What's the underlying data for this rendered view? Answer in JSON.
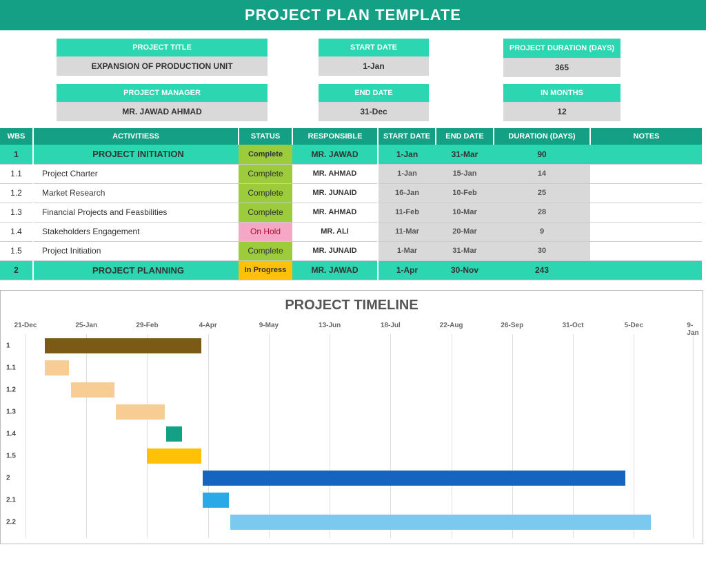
{
  "title": "PROJECT PLAN TEMPLATE",
  "meta": {
    "project_title": {
      "label": "PROJECT TITLE",
      "value": "EXPANSION OF PRODUCTION UNIT"
    },
    "start_date": {
      "label": "START DATE",
      "value": "1-Jan"
    },
    "duration_days": {
      "label": "PROJECT DURATION (DAYS)",
      "value": "365"
    },
    "manager": {
      "label": "PROJECT MANAGER",
      "value": "MR. JAWAD AHMAD"
    },
    "end_date": {
      "label": "END DATE",
      "value": "31-Dec"
    },
    "in_months": {
      "label": "IN MONTHS",
      "value": "12"
    }
  },
  "columns": {
    "wbs": "WBS",
    "activities": "ACTIVITIESS",
    "status": "STATUS",
    "responsible": "RESPONSIBLE",
    "start": "START DATE",
    "end": "END DATE",
    "duration": "DURATION (DAYS)",
    "notes": "NOTES"
  },
  "rows": [
    {
      "group": true,
      "wbs": "1",
      "activity": "PROJECT INITIATION",
      "status": "Complete",
      "status_cls": "st-g-complete",
      "resp": "MR. JAWAD",
      "start": "1-Jan",
      "end": "31-Mar",
      "dur": "90"
    },
    {
      "group": false,
      "wbs": "1.1",
      "activity": "Project Charter",
      "status": "Complete",
      "status_cls": "st-complete",
      "resp": "MR. AHMAD",
      "start": "1-Jan",
      "end": "15-Jan",
      "dur": "14"
    },
    {
      "group": false,
      "wbs": "1.2",
      "activity": "Market Research",
      "status": "Complete",
      "status_cls": "st-complete",
      "resp": "MR. JUNAID",
      "start": "16-Jan",
      "end": "10-Feb",
      "dur": "25"
    },
    {
      "group": false,
      "wbs": "1.3",
      "activity": "Financial Projects and Feasbilities",
      "status": "Complete",
      "status_cls": "st-complete",
      "resp": "MR. AHMAD",
      "start": "11-Feb",
      "end": "10-Mar",
      "dur": "28"
    },
    {
      "group": false,
      "wbs": "1.4",
      "activity": "Stakeholders Engagement",
      "status": "On Hold",
      "status_cls": "st-onhold",
      "resp": "MR. ALI",
      "start": "11-Mar",
      "end": "20-Mar",
      "dur": "9"
    },
    {
      "group": false,
      "wbs": "1.5",
      "activity": "Project Initiation",
      "status": "Complete",
      "status_cls": "st-complete",
      "resp": "MR. JUNAID",
      "start": "1-Mar",
      "end": "31-Mar",
      "dur": "30"
    },
    {
      "group": true,
      "wbs": "2",
      "activity": "PROJECT PLANNING",
      "status": "In Progress",
      "status_cls": "st-g-inprog",
      "resp": "MR. JAWAD",
      "start": "1-Apr",
      "end": "30-Nov",
      "dur": "243"
    }
  ],
  "timeline": {
    "title": "PROJECT TIMELINE",
    "start_day": 0,
    "end_day": 384,
    "dates": [
      {
        "label": "21-Dec",
        "day": 0
      },
      {
        "label": "25-Jan",
        "day": 35
      },
      {
        "label": "29-Feb",
        "day": 70
      },
      {
        "label": "4-Apr",
        "day": 105
      },
      {
        "label": "9-May",
        "day": 140
      },
      {
        "label": "13-Jun",
        "day": 175
      },
      {
        "label": "18-Jul",
        "day": 210
      },
      {
        "label": "22-Aug",
        "day": 245
      },
      {
        "label": "26-Sep",
        "day": 280
      },
      {
        "label": "31-Oct",
        "day": 315
      },
      {
        "label": "5-Dec",
        "day": 350
      },
      {
        "label": "9-Jan",
        "day": 384
      }
    ],
    "rows": [
      {
        "label": "1",
        "cls": "bar-1",
        "start": 11,
        "end": 101
      },
      {
        "label": "1.1",
        "cls": "bar-11",
        "start": 11,
        "end": 25
      },
      {
        "label": "1.2",
        "cls": "bar-12",
        "start": 26,
        "end": 51
      },
      {
        "label": "1.3",
        "cls": "bar-13",
        "start": 52,
        "end": 80
      },
      {
        "label": "1.4",
        "cls": "bar-14",
        "start": 81,
        "end": 90
      },
      {
        "label": "1.5",
        "cls": "bar-15",
        "start": 70,
        "end": 101
      },
      {
        "label": "2",
        "cls": "bar-2",
        "start": 102,
        "end": 345
      },
      {
        "label": "2.1",
        "cls": "bar-21",
        "start": 102,
        "end": 117
      },
      {
        "label": "2.2",
        "cls": "bar-22",
        "start": 118,
        "end": 360
      }
    ]
  },
  "chart_data": {
    "type": "bar",
    "title": "PROJECT TIMELINE",
    "xlabel": "",
    "ylabel": "",
    "x_ticks": [
      "21-Dec",
      "25-Jan",
      "29-Feb",
      "4-Apr",
      "9-May",
      "13-Jun",
      "18-Jul",
      "22-Aug",
      "26-Sep",
      "31-Oct",
      "5-Dec",
      "9-Jan"
    ],
    "series": [
      {
        "name": "1",
        "start": "1-Jan",
        "end": "31-Mar",
        "duration": 90,
        "color": "#7b5a16"
      },
      {
        "name": "1.1",
        "start": "1-Jan",
        "end": "15-Jan",
        "duration": 14,
        "color": "#f7cd94"
      },
      {
        "name": "1.2",
        "start": "16-Jan",
        "end": "10-Feb",
        "duration": 25,
        "color": "#f7cd94"
      },
      {
        "name": "1.3",
        "start": "11-Feb",
        "end": "10-Mar",
        "duration": 28,
        "color": "#f7cd94"
      },
      {
        "name": "1.4",
        "start": "11-Mar",
        "end": "20-Mar",
        "duration": 9,
        "color": "#14a085"
      },
      {
        "name": "1.5",
        "start": "1-Mar",
        "end": "31-Mar",
        "duration": 30,
        "color": "#ffc107"
      },
      {
        "name": "2",
        "start": "1-Apr",
        "end": "30-Nov",
        "duration": 243,
        "color": "#1565c0"
      },
      {
        "name": "2.1",
        "start": "1-Apr",
        "end": "16-Apr",
        "duration": 15,
        "color": "#29a9e8"
      },
      {
        "name": "2.2",
        "start": "17-Apr",
        "end": "15-Dec",
        "duration": 242,
        "color": "#7bc9ef"
      }
    ]
  }
}
